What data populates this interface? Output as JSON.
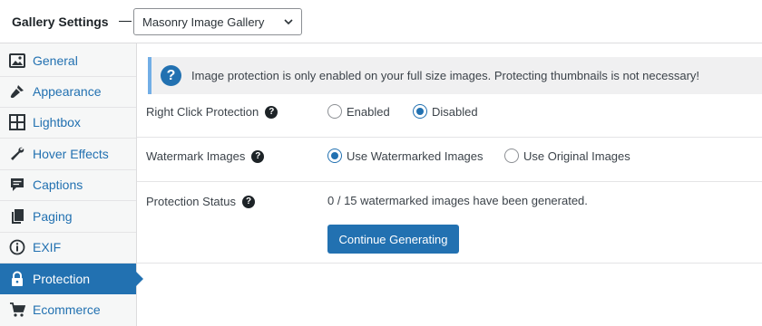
{
  "header": {
    "title": "Gallery Settings",
    "gallery_select": {
      "value": "Masonry Image Gallery"
    }
  },
  "sidebar": {
    "items": [
      {
        "label": "General",
        "icon": "image-icon"
      },
      {
        "label": "Appearance",
        "icon": "brush-icon"
      },
      {
        "label": "Lightbox",
        "icon": "grid-icon"
      },
      {
        "label": "Hover Effects",
        "icon": "wrench-icon"
      },
      {
        "label": "Captions",
        "icon": "speech-bubble-icon"
      },
      {
        "label": "Paging",
        "icon": "pages-icon"
      },
      {
        "label": "EXIF",
        "icon": "info-icon"
      },
      {
        "label": "Protection",
        "icon": "lock-icon",
        "active": true
      },
      {
        "label": "Ecommerce",
        "icon": "cart-icon"
      }
    ]
  },
  "notice": {
    "text": "Image protection is only enabled on your full size images. Protecting thumbnails is not necessary!"
  },
  "settings": {
    "right_click": {
      "label": "Right Click Protection",
      "options": [
        "Enabled",
        "Disabled"
      ],
      "selected": "Disabled"
    },
    "watermark": {
      "label": "Watermark Images",
      "options": [
        "Use Watermarked Images",
        "Use Original Images"
      ],
      "selected": "Use Watermarked Images"
    },
    "status": {
      "label": "Protection Status",
      "text": "0 / 15 watermarked images have been generated.",
      "button": "Continue Generating"
    }
  },
  "colors": {
    "accent": "#2271b1",
    "notice_border": "#72aee6",
    "sidebar_bg": "#f6f7f7"
  }
}
